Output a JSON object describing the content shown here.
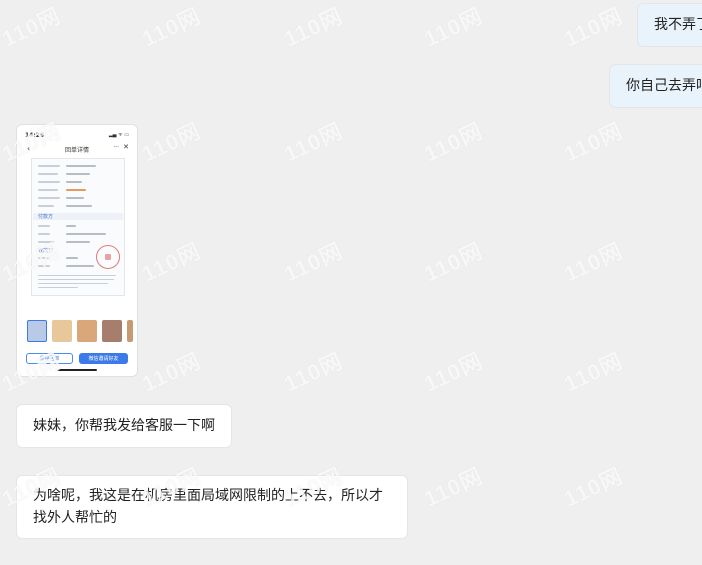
{
  "messages": {
    "right_1": "我不弄了",
    "right_2": "你自己去弄吧",
    "left_1": "妹妹，你帮我发给客服一下啊",
    "left_2": "为啥呢，我这是在机房里面局域网限制的上不去，所以才找外人帮忙的"
  },
  "phone": {
    "status_time": "14:28",
    "title": "回单详情",
    "section_payer": "付款方",
    "section_payee": "收款方",
    "save_button": "保存回单",
    "share_button": "微信邀请好友",
    "thumb_colors": [
      "#b9c9e6",
      "#e8c79a",
      "#d9a77a",
      "#a77d6e",
      "#c89a72"
    ]
  },
  "watermark": {
    "text": "110网"
  }
}
